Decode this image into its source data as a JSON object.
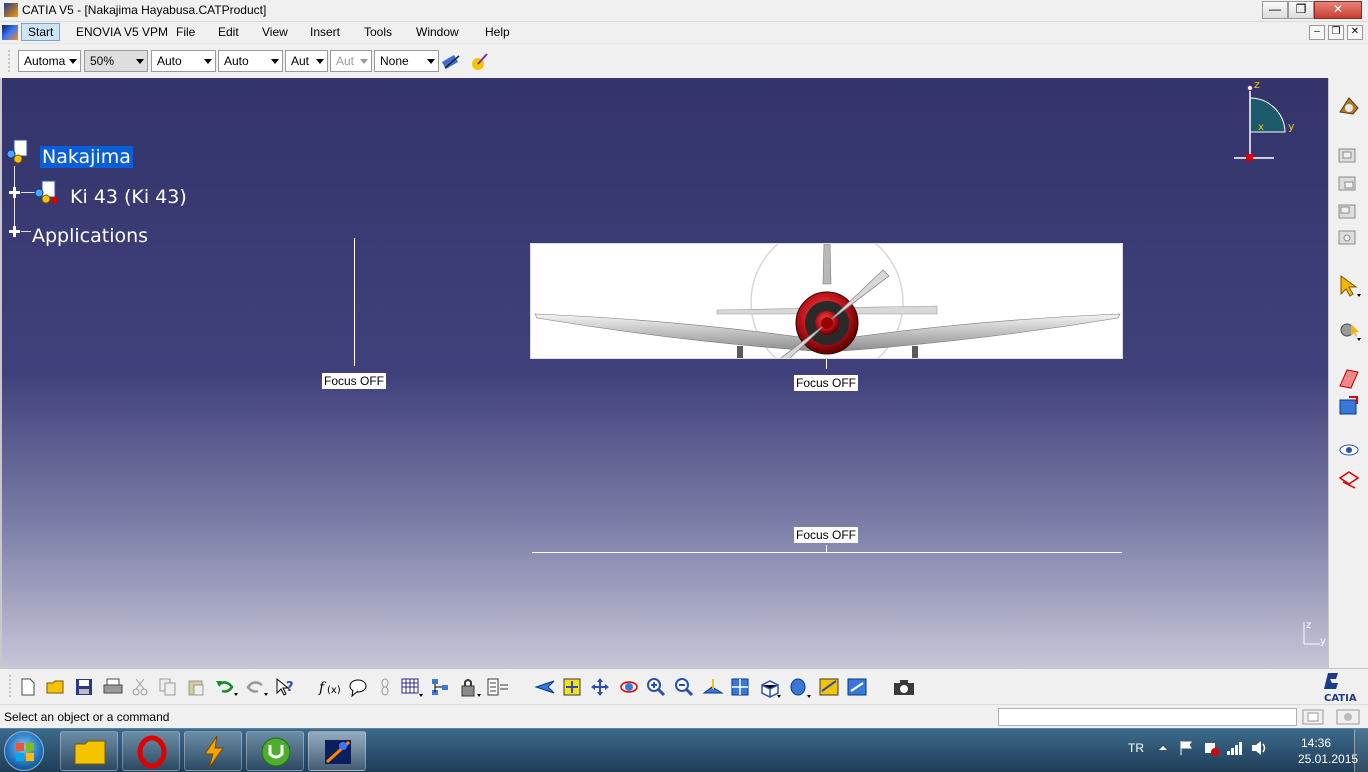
{
  "window": {
    "title": "CATIA V5 - [Nakajima Hayabusa.CATProduct]",
    "minimize": "—",
    "maximize": "❐",
    "close": "✕"
  },
  "menu": {
    "start": "Start",
    "enovia": "ENOVIA V5 VPM",
    "file": "File",
    "edit": "Edit",
    "view": "View",
    "insert": "Insert",
    "tools": "Tools",
    "window": "Window",
    "help": "Help",
    "mdi_min": "–",
    "mdi_restore": "❐",
    "mdi_close": "✕"
  },
  "properties_toolbar": {
    "combos": [
      {
        "value": "Automa",
        "disabled": false
      },
      {
        "value": "50%",
        "disabled": false
      },
      {
        "value": "Auto",
        "disabled": false
      },
      {
        "value": "Auto",
        "disabled": false
      },
      {
        "value": "Aut",
        "disabled": false
      },
      {
        "value": "Aut",
        "disabled": true
      },
      {
        "value": "None",
        "disabled": false
      }
    ]
  },
  "tree": {
    "root": "Nakajima",
    "child": "Ki 43 (Ki 43)",
    "applications": "Applications"
  },
  "viewport": {
    "focus_labels": [
      "Focus OFF",
      "Focus OFF",
      "Focus OFF"
    ],
    "compass": {
      "z": "z",
      "x": "x",
      "y": "y"
    },
    "mini_axis": {
      "z": "z",
      "y": "y"
    }
  },
  "bottom_toolbar": {
    "logo": "CATIA"
  },
  "status": {
    "prompt": "Select an object or a command"
  },
  "taskbar": {
    "language": "TR",
    "time": "14:36",
    "date": "25.01.2015"
  },
  "colors": {
    "viewport_top": "#34346b",
    "viewport_bottom": "#c6c6d8",
    "selection": "#0a5fd9",
    "compass_teal": "#1d5a6b",
    "propeller_red": "#c0141a"
  }
}
